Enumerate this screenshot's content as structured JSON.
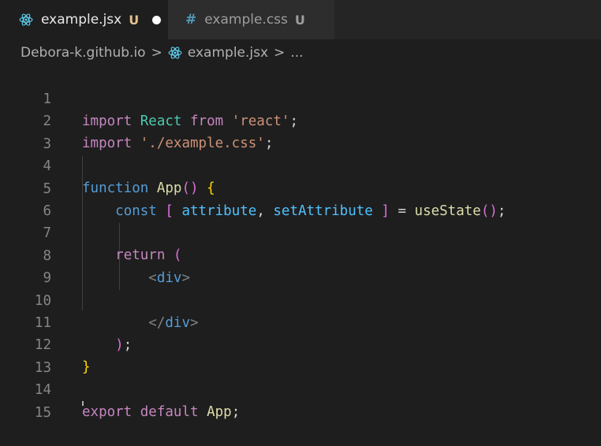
{
  "tabs": [
    {
      "filename": "example.jsx",
      "status": "U",
      "icon": "react-icon"
    },
    {
      "filename": "example.css",
      "status": "U",
      "icon": "css-hash-icon",
      "glyph": "#"
    }
  ],
  "breadcrumb": {
    "folder": "Debora-k.github.io",
    "sep": ">",
    "file": "example.jsx",
    "sep2": ">",
    "more": "..."
  },
  "editor": {
    "line_numbers": [
      "1",
      "2",
      "3",
      "4",
      "5",
      "6",
      "7",
      "8",
      "9",
      "10",
      "11",
      "12",
      "13",
      "14",
      "15"
    ],
    "lines": {
      "l1": {
        "t0": "import",
        "t1": " ",
        "t2": "React",
        "t3": " ",
        "t4": "from",
        "t5": " ",
        "t6": "'react'",
        "t7": ";"
      },
      "l2": {
        "t0": "import",
        "t1": " ",
        "t2": "'./example.css'",
        "t3": ";"
      },
      "l4": {
        "t0": "function",
        "t1": " ",
        "t2": "App",
        "t3": "()",
        "t4": " ",
        "t5": "{"
      },
      "l5": {
        "t0": "    ",
        "t1": "const",
        "t2": " ",
        "t3": "[",
        "t4": " ",
        "t5": "attribute",
        "t6": ", ",
        "t7": "setAttribute",
        "t8": " ",
        "t9": "]",
        "t10": " = ",
        "t11": "useState",
        "t12": "()",
        "t13": ";"
      },
      "l7": {
        "t0": "    ",
        "t1": "return",
        "t2": " ",
        "t3": "("
      },
      "l8": {
        "t0": "        ",
        "t1": "<",
        "t2": "div",
        "t3": ">"
      },
      "l10": {
        "t0": "        ",
        "t1": "</",
        "t2": "div",
        "t3": ">"
      },
      "l11": {
        "t0": "    ",
        "t1": ")",
        "t2": ";"
      },
      "l12": {
        "t0": "}"
      },
      "l14": {
        "t0": "export",
        "t1": " ",
        "t2": "default",
        "t3": " ",
        "t4": "App",
        "t5": ";"
      }
    }
  },
  "colors": {
    "keyword": "#569cd6",
    "control": "#c586c0",
    "string": "#ce9178",
    "function": "#dcdcaa",
    "variable": "#9cdcfe",
    "constant": "#4fc1ff",
    "class": "#4ec9b0",
    "bracket_level1": "#ffd700",
    "bracket_level2": "#da70d6",
    "bracket_level3": "#179fff",
    "modified": "#e2c08d"
  }
}
